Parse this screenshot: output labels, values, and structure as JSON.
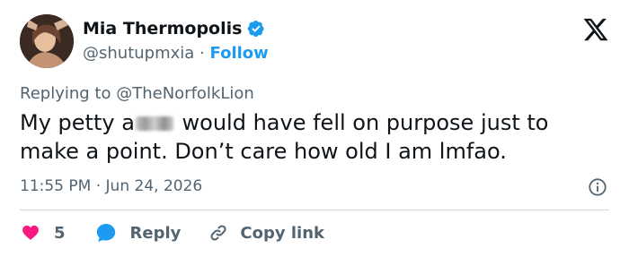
{
  "author": {
    "name": "Mia Thermopolis",
    "handle": "@shutupmxia",
    "separator": "·",
    "follow_label": "Follow"
  },
  "replying": {
    "prefix": "Replying to",
    "mention": "@TheNorfolkLion"
  },
  "tweet": {
    "text_before": "My petty a",
    "text_after": " would have fell on purpose just to make a point. Don’t care how old I am lmfao."
  },
  "meta": {
    "time": "11:55 PM",
    "separator": "·",
    "date": "Jun 24, 2026"
  },
  "actions": {
    "like_count": "5",
    "reply_label": "Reply",
    "copy_label": "Copy link"
  },
  "colors": {
    "accent": "#1d9bf0",
    "like": "#f91880",
    "text": "#0f1419",
    "muted": "#536471",
    "divider": "#cfd9de"
  },
  "icons": [
    "verified-badge-icon",
    "x-logo-icon",
    "info-icon",
    "heart-icon",
    "reply-bubble-icon",
    "link-icon"
  ]
}
